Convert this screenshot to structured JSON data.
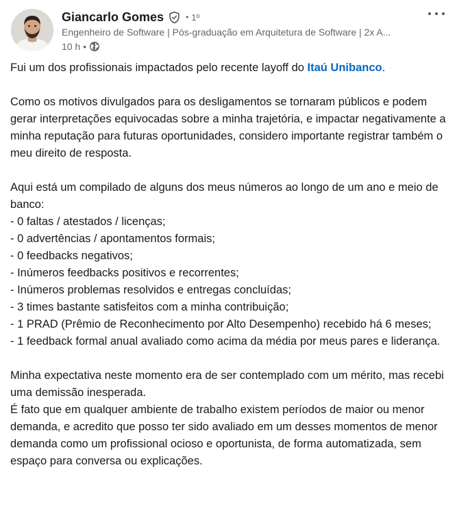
{
  "author": {
    "name": "Giancarlo Gomes",
    "connection_degree": "1º",
    "headline": "Engenheiro de Software | Pós-graduação em Arquitetura de Software | 2x A...",
    "time": "10 h",
    "bullet": "•"
  },
  "post": {
    "p1_before": "Fui um dos profissionais impactados pelo recente layoff do ",
    "p1_mention": "Itaú Unibanco",
    "p1_after": ".",
    "p2": "Como os motivos divulgados para os desligamentos se tornaram públicos e podem gerar interpretações equivocadas sobre a minha trajetória, e impactar negativamente a minha reputação para futuras oportunidades, considero importante registrar também o meu direito de resposta.",
    "p3_intro": "Aqui está um compilado de alguns dos meus números ao longo de um ano e meio de banco:",
    "list": [
      "- 0 faltas / atestados / licenças;",
      "- 0 advertências / apontamentos formais;",
      "- 0 feedbacks negativos;",
      "- Inúmeros feedbacks positivos e recorrentes;",
      "- Inúmeros problemas resolvidos e entregas concluídas;",
      "- 3 times bastante satisfeitos com a minha contribuição;",
      "- 1 PRAD (Prêmio de Reconhecimento por Alto Desempenho) recebido há 6 meses;",
      "- 1 feedback formal anual avaliado como acima da média por meus pares e liderança."
    ],
    "p4a": "Minha expectativa neste momento era de ser contemplado com um mérito, mas recebi uma demissão inesperada.",
    "p4b": "É fato que em qualquer ambiente de trabalho existem períodos de maior ou menor demanda, e acredito que posso ter sido avaliado em um desses momentos de menor demanda como um profissional ocioso e oportunista, de forma automatizada, sem espaço para conversa ou explicações."
  },
  "icons": {
    "verified": "verified-shield-icon",
    "globe": "globe-icon",
    "more": "more-options-icon"
  },
  "colors": {
    "mention": "#0a66c2",
    "secondary_text": "#666666",
    "primary_text": "#191919"
  }
}
